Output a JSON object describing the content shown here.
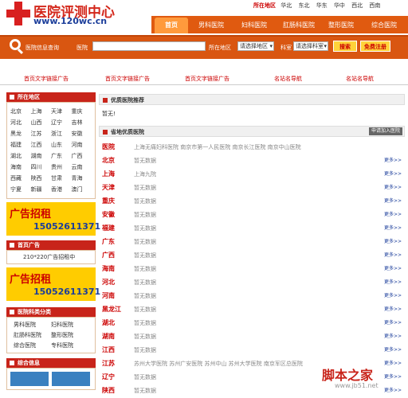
{
  "site": {
    "title": "医院评测中心",
    "url": "www.120wc.cn"
  },
  "regions": {
    "label": "所在地区",
    "items": [
      "华北",
      "东北",
      "华东",
      "华中",
      "西北",
      "西南"
    ]
  },
  "nav": {
    "items": [
      "首页",
      "男科医院",
      "妇科医院",
      "肛肠科医院",
      "整形医院",
      "综合医院"
    ],
    "active_index": 0
  },
  "search": {
    "section_label": "医院信息查询",
    "hospital_label": "医院",
    "region_label": "所在地区",
    "region_value": "请选择地区",
    "category_label": "科室",
    "category_value": "请选择科室",
    "search_button": "搜索",
    "register_button": "免费注册"
  },
  "ads": [
    "首页文字链接广告",
    "首页文字链接广告",
    "首页文字链接广告",
    "名站名导航",
    "名站名导航"
  ],
  "left": {
    "region_header": "所在地区",
    "cities": [
      "北京",
      "上海",
      "天津",
      "重庆",
      "河北",
      "山西",
      "辽宁",
      "吉林",
      "黑龙",
      "江苏",
      "浙江",
      "安徽",
      "福建",
      "江西",
      "山东",
      "河南",
      "湖北",
      "湖南",
      "广东",
      "广西",
      "海南",
      "四川",
      "贵州",
      "云南",
      "西藏",
      "陕西",
      "甘肃",
      "青海",
      "宁夏",
      "新疆",
      "香港",
      "澳门"
    ],
    "ad1": {
      "text": "广告招租",
      "phone": "15052611371"
    },
    "small_ad_header": "首页广告",
    "small_ad_body": "210*220广告招租中",
    "ad2": {
      "text": "广告招租",
      "phone": "15052611371"
    },
    "cat_header": "医院科类分类",
    "categories": [
      "男科医院",
      "妇科医院",
      "肛肠科医院",
      "整形医院",
      "综合医院",
      "专科医院"
    ],
    "ad3_header": "综合信息"
  },
  "right": {
    "recommend_header": "优质医院推荐",
    "info_label": "暂无!",
    "hospitals_header": "省地优质医院",
    "apply_button": "申请加入医院",
    "rows": [
      {
        "prov": "医院",
        "hosp": "上海无痛妇科医院   南京市第一人民医院   南京长江医院   南京中山医院"
      },
      {
        "prov": "北京",
        "hosp": "暂无数据"
      },
      {
        "prov": "上海",
        "hosp": "上海九院"
      },
      {
        "prov": "天津",
        "hosp": "暂无数据"
      },
      {
        "prov": "重庆",
        "hosp": "暂无数据"
      },
      {
        "prov": "安徽",
        "hosp": "暂无数据"
      },
      {
        "prov": "福建",
        "hosp": "暂无数据"
      },
      {
        "prov": "广东",
        "hosp": "暂无数据"
      },
      {
        "prov": "广西",
        "hosp": "暂无数据"
      },
      {
        "prov": "海南",
        "hosp": "暂无数据"
      },
      {
        "prov": "河北",
        "hosp": "暂无数据"
      },
      {
        "prov": "河南",
        "hosp": "暂无数据"
      },
      {
        "prov": "黑龙江",
        "hosp": "暂无数据"
      },
      {
        "prov": "湖北",
        "hosp": "暂无数据"
      },
      {
        "prov": "湖南",
        "hosp": "暂无数据"
      },
      {
        "prov": "江西",
        "hosp": "暂无数据"
      },
      {
        "prov": "江苏",
        "hosp": "苏州大学医院   苏州广安医院   苏州中山   苏州大学医院   南京军区总医院"
      },
      {
        "prov": "辽宁",
        "hosp": "暂无数据"
      },
      {
        "prov": "陕西",
        "hosp": "暂无数据"
      }
    ],
    "more_label": "更多>>"
  },
  "watermark": {
    "cn": "脚本之家",
    "url": "www.jb51.net"
  }
}
